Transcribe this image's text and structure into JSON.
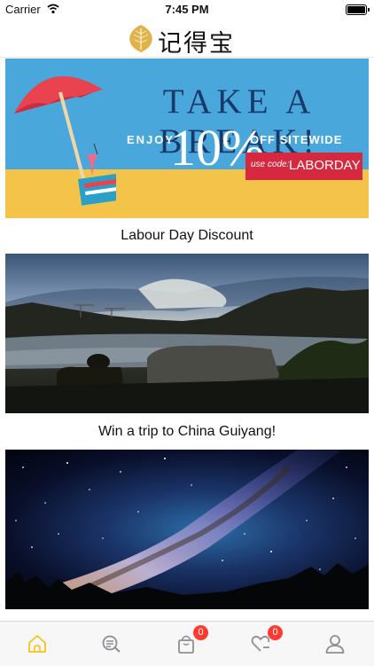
{
  "status_bar": {
    "carrier": "Carrier",
    "time": "7:45 PM"
  },
  "header": {
    "app_title": "记得宝"
  },
  "feed": [
    {
      "caption": "Labour Day Discount",
      "banner": {
        "headline": "TAKE A BREAK!",
        "enjoy": "ENJOY",
        "percent": "10%",
        "off": "OFF SITEWIDE",
        "code_prefix": "use code:",
        "code": "LABORDAY"
      }
    },
    {
      "caption": "Win a trip to China Guiyang!"
    },
    {
      "caption": ""
    }
  ],
  "tab_bar": {
    "items": [
      {
        "icon": "home-icon",
        "active": true
      },
      {
        "icon": "search-list-icon",
        "active": false
      },
      {
        "icon": "shopping-bag-icon",
        "badge": "0"
      },
      {
        "icon": "heart-minus-icon",
        "badge": "0"
      },
      {
        "icon": "user-icon",
        "active": false
      }
    ]
  },
  "colors": {
    "accent": "#f5c518",
    "badge": "#ff3b30",
    "promo_red": "#d6293f"
  }
}
